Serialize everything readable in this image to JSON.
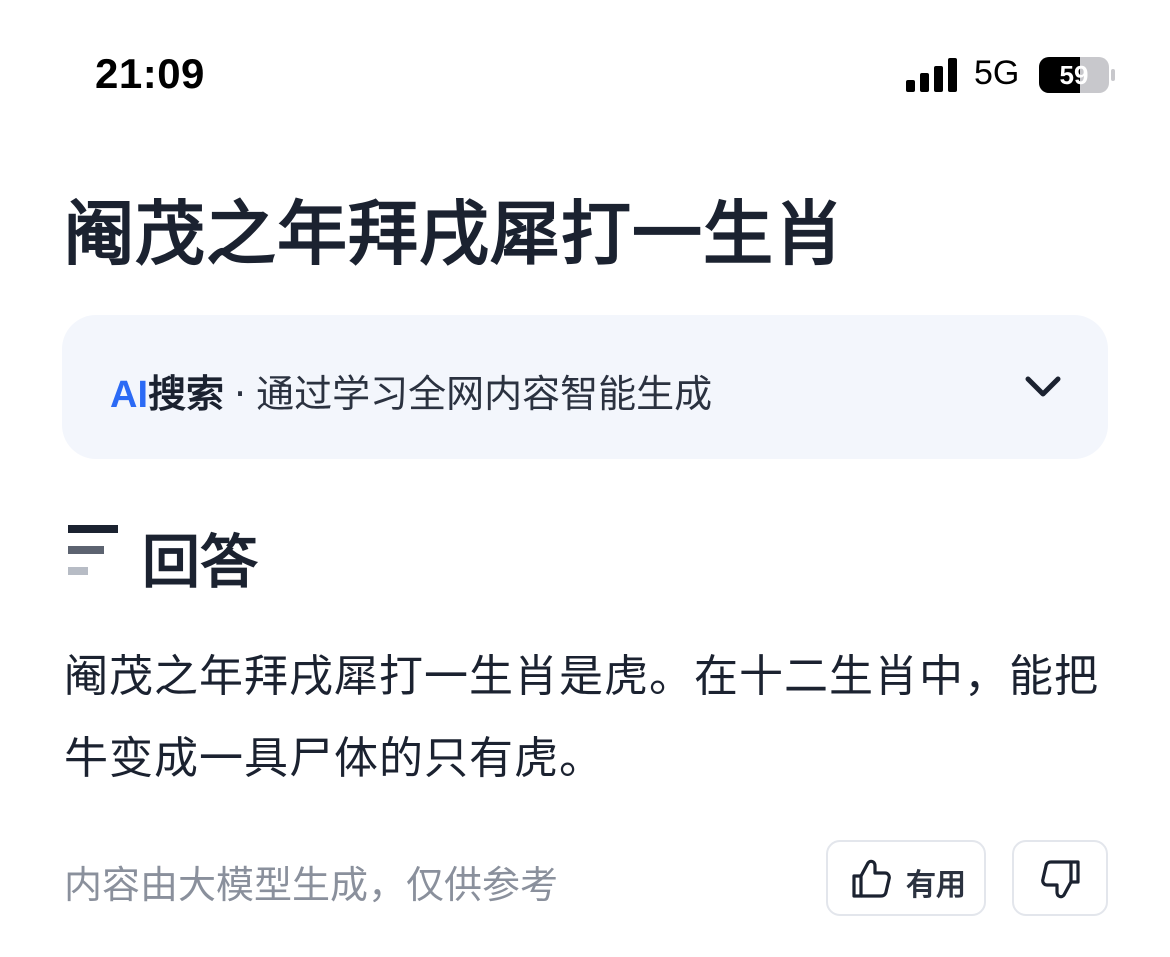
{
  "status_bar": {
    "time": "21:09",
    "network": "5G",
    "battery": "59"
  },
  "page": {
    "title": "阉茂之年拜戌犀打一生肖"
  },
  "ai_banner": {
    "ai_label": "AI",
    "search_label": "搜索",
    "separator": "·",
    "description": "通过学习全网内容智能生成",
    "icon": "chevron-down-icon"
  },
  "answer": {
    "heading": "回答",
    "heading_icon": "answer-lines-icon",
    "body": "阉茂之年拜戌犀打一生肖是虎。在十二生肖中，能把牛变成一具尸体的只有虎。"
  },
  "footer": {
    "disclaimer": "内容由大模型生成，仅供参考",
    "useful_label": "有用",
    "useful_icon": "thumb-up-icon",
    "dislike_icon": "thumb-down-icon"
  },
  "colors": {
    "accent_blue": "#2b6af5",
    "banner_bg": "#f3f6fc",
    "text_dark": "#1b2230",
    "text_muted": "#8a909c"
  }
}
